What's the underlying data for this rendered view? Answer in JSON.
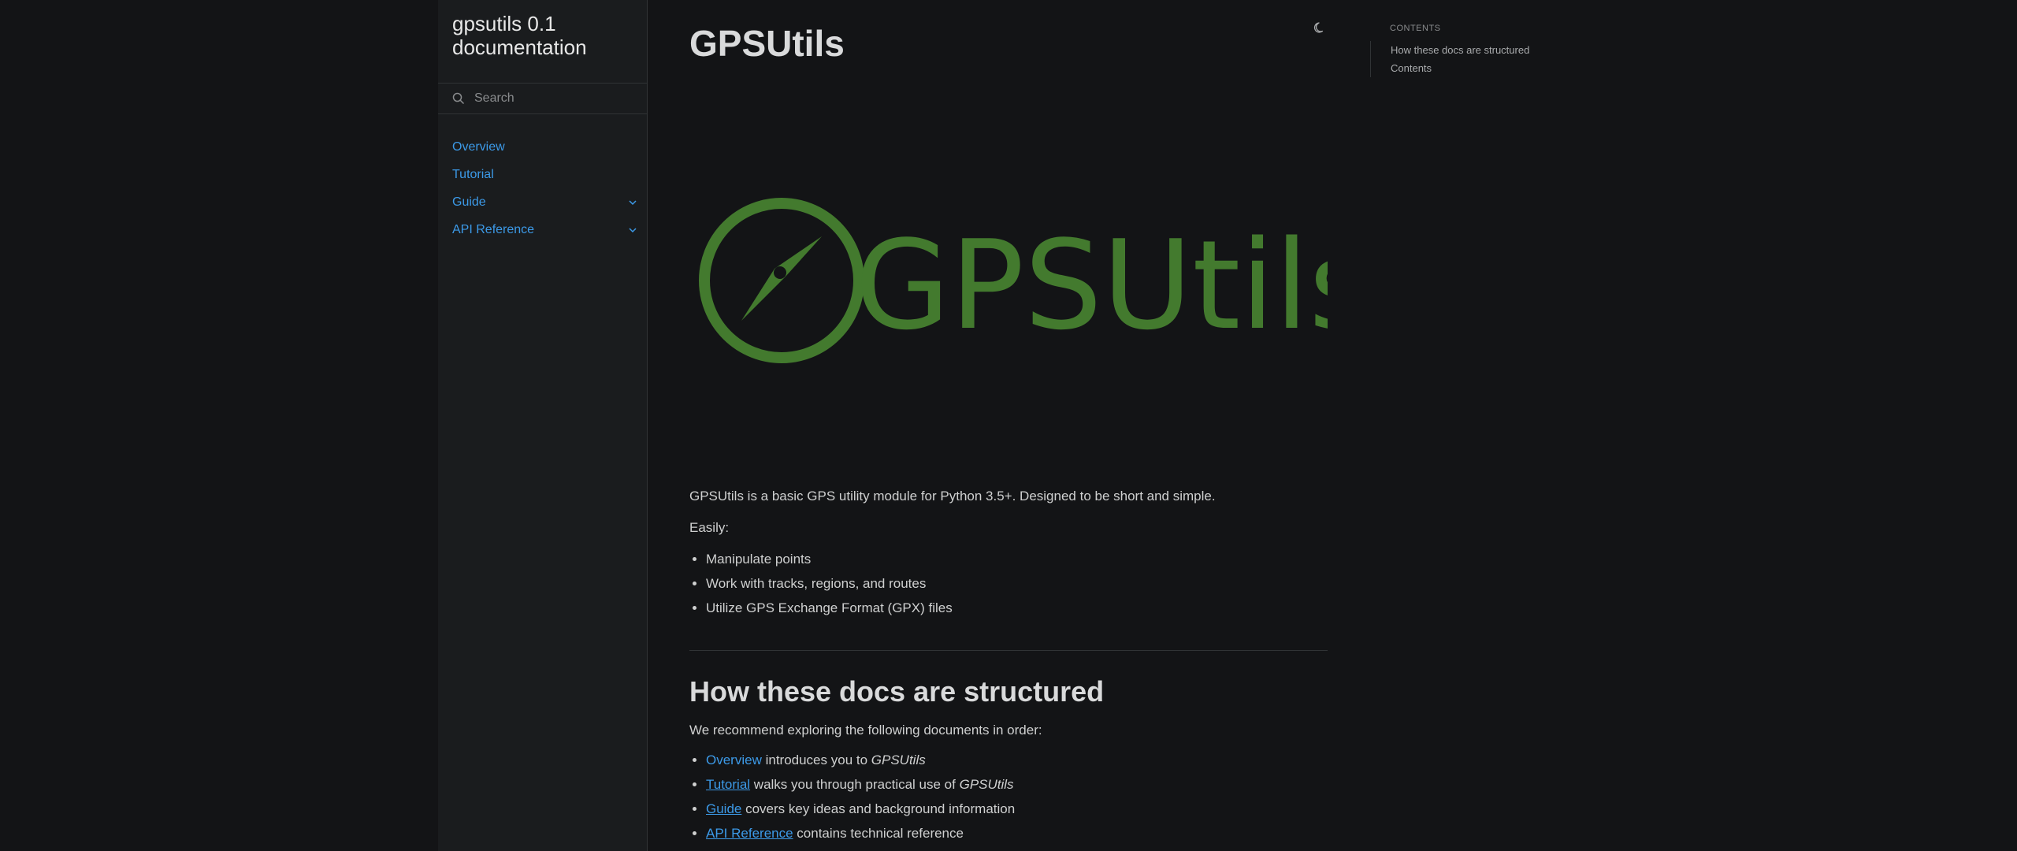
{
  "sidebar": {
    "brand": "gpsutils 0.1 documentation",
    "search_placeholder": "Search",
    "items": [
      {
        "label": "Overview",
        "has_children": false
      },
      {
        "label": "Tutorial",
        "has_children": false
      },
      {
        "label": "Guide",
        "has_children": true
      },
      {
        "label": "API Reference",
        "has_children": true
      }
    ]
  },
  "main": {
    "title": "GPSUtils",
    "logo_text": "GPSUtils",
    "intro": "GPSUtils is a basic GPS utility module for Python 3.5+. Designed to be short and simple.",
    "easily_label": "Easily:",
    "features": [
      "Manipulate points",
      "Work with tracks, regions, and routes",
      "Utilize GPS Exchange Format (GPX) files"
    ],
    "section_heading": "How these docs are structured",
    "recommend_text": "We recommend exploring the following documents in order:",
    "docs": [
      {
        "link": "Overview",
        "text": " introduces you to ",
        "em": "GPSUtils"
      },
      {
        "link": "Tutorial",
        "text": " walks you through practical use of ",
        "em": "GPSUtils"
      },
      {
        "link": "Guide",
        "text": " covers key ideas and background information",
        "em": ""
      },
      {
        "link": "API Reference",
        "text": " contains technical reference",
        "em": ""
      }
    ]
  },
  "toc": {
    "title": "CONTENTS",
    "items": [
      "How these docs are structured",
      "Contents"
    ]
  },
  "colors": {
    "background": "#131416",
    "sidebar_bg": "#1a1c1e",
    "link": "#3c9ae8",
    "logo_green": "#437a2e"
  },
  "icons": {
    "search": "search-icon",
    "chevron": "chevron-down-icon",
    "theme": "moon-icon",
    "compass": "compass-icon"
  }
}
